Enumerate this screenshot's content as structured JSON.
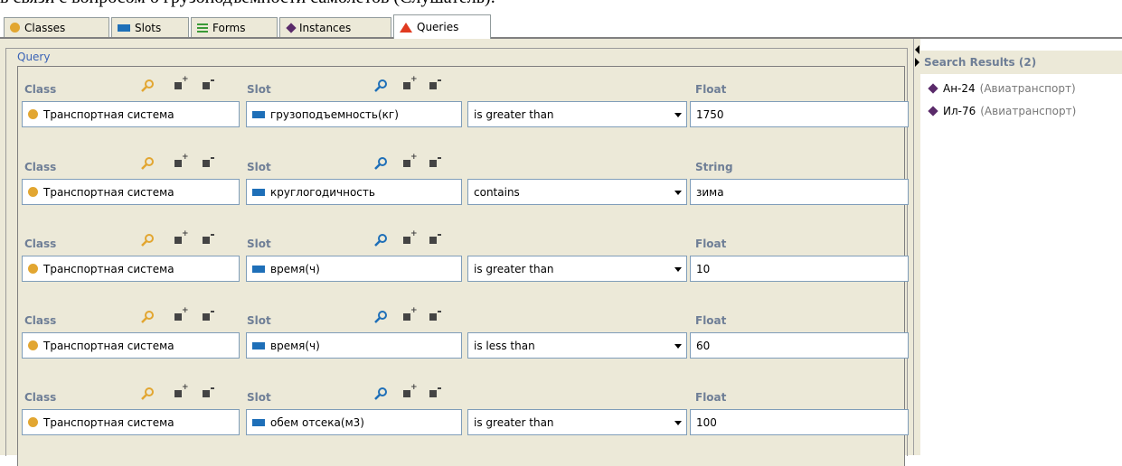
{
  "doc_line": "в связи с вопросом о грузоподъемности самолетов (Слушатель):",
  "tabs": [
    {
      "label": "Classes",
      "icon": "class-circle-icon"
    },
    {
      "label": "Slots",
      "icon": "slot-rect-icon"
    },
    {
      "label": "Forms",
      "icon": "forms-icon"
    },
    {
      "label": "Instances",
      "icon": "instance-diamond-icon"
    },
    {
      "label": "Queries",
      "icon": "query-triangle-icon"
    }
  ],
  "active_tab": "Queries",
  "query": {
    "legend": "Query",
    "rows": [
      {
        "class_label": "Class",
        "slot_label": "Slot",
        "class_value": "Транспортная система",
        "slot_value": "грузоподъемность(кг)",
        "operator": "is greater than",
        "value_label": "Float",
        "value": "1750"
      },
      {
        "class_label": "Class",
        "slot_label": "Slot",
        "class_value": "Транспортная система",
        "slot_value": "круглогодичность",
        "operator": "contains",
        "value_label": "String",
        "value": "зима"
      },
      {
        "class_label": "Class",
        "slot_label": "Slot",
        "class_value": "Транспортная система",
        "slot_value": "время(ч)",
        "operator": "is greater than",
        "value_label": "Float",
        "value": "10"
      },
      {
        "class_label": "Class",
        "slot_label": "Slot",
        "class_value": "Транспортная система",
        "slot_value": "время(ч)",
        "operator": "is less than",
        "value_label": "Float",
        "value": "60"
      },
      {
        "class_label": "Class",
        "slot_label": "Slot",
        "class_value": "Транспортная система",
        "slot_value": "обем отсека(м3)",
        "operator": "is greater than",
        "value_label": "Float",
        "value": "100"
      }
    ]
  },
  "results": {
    "title": "Search Results (2)",
    "items": [
      {
        "name": "Ан-24",
        "class": "(Авиатранспорт)"
      },
      {
        "name": "Ил-76",
        "class": "(Авиатранспорт)"
      }
    ]
  },
  "colors": {
    "class_icon": "#e2a631",
    "slot_icon": "#1e6fb8",
    "instance_icon": "#5a2a6a",
    "query_icon": "#e03a20",
    "label_text": "#6e7e96",
    "panel_bg": "#ece9d8"
  }
}
